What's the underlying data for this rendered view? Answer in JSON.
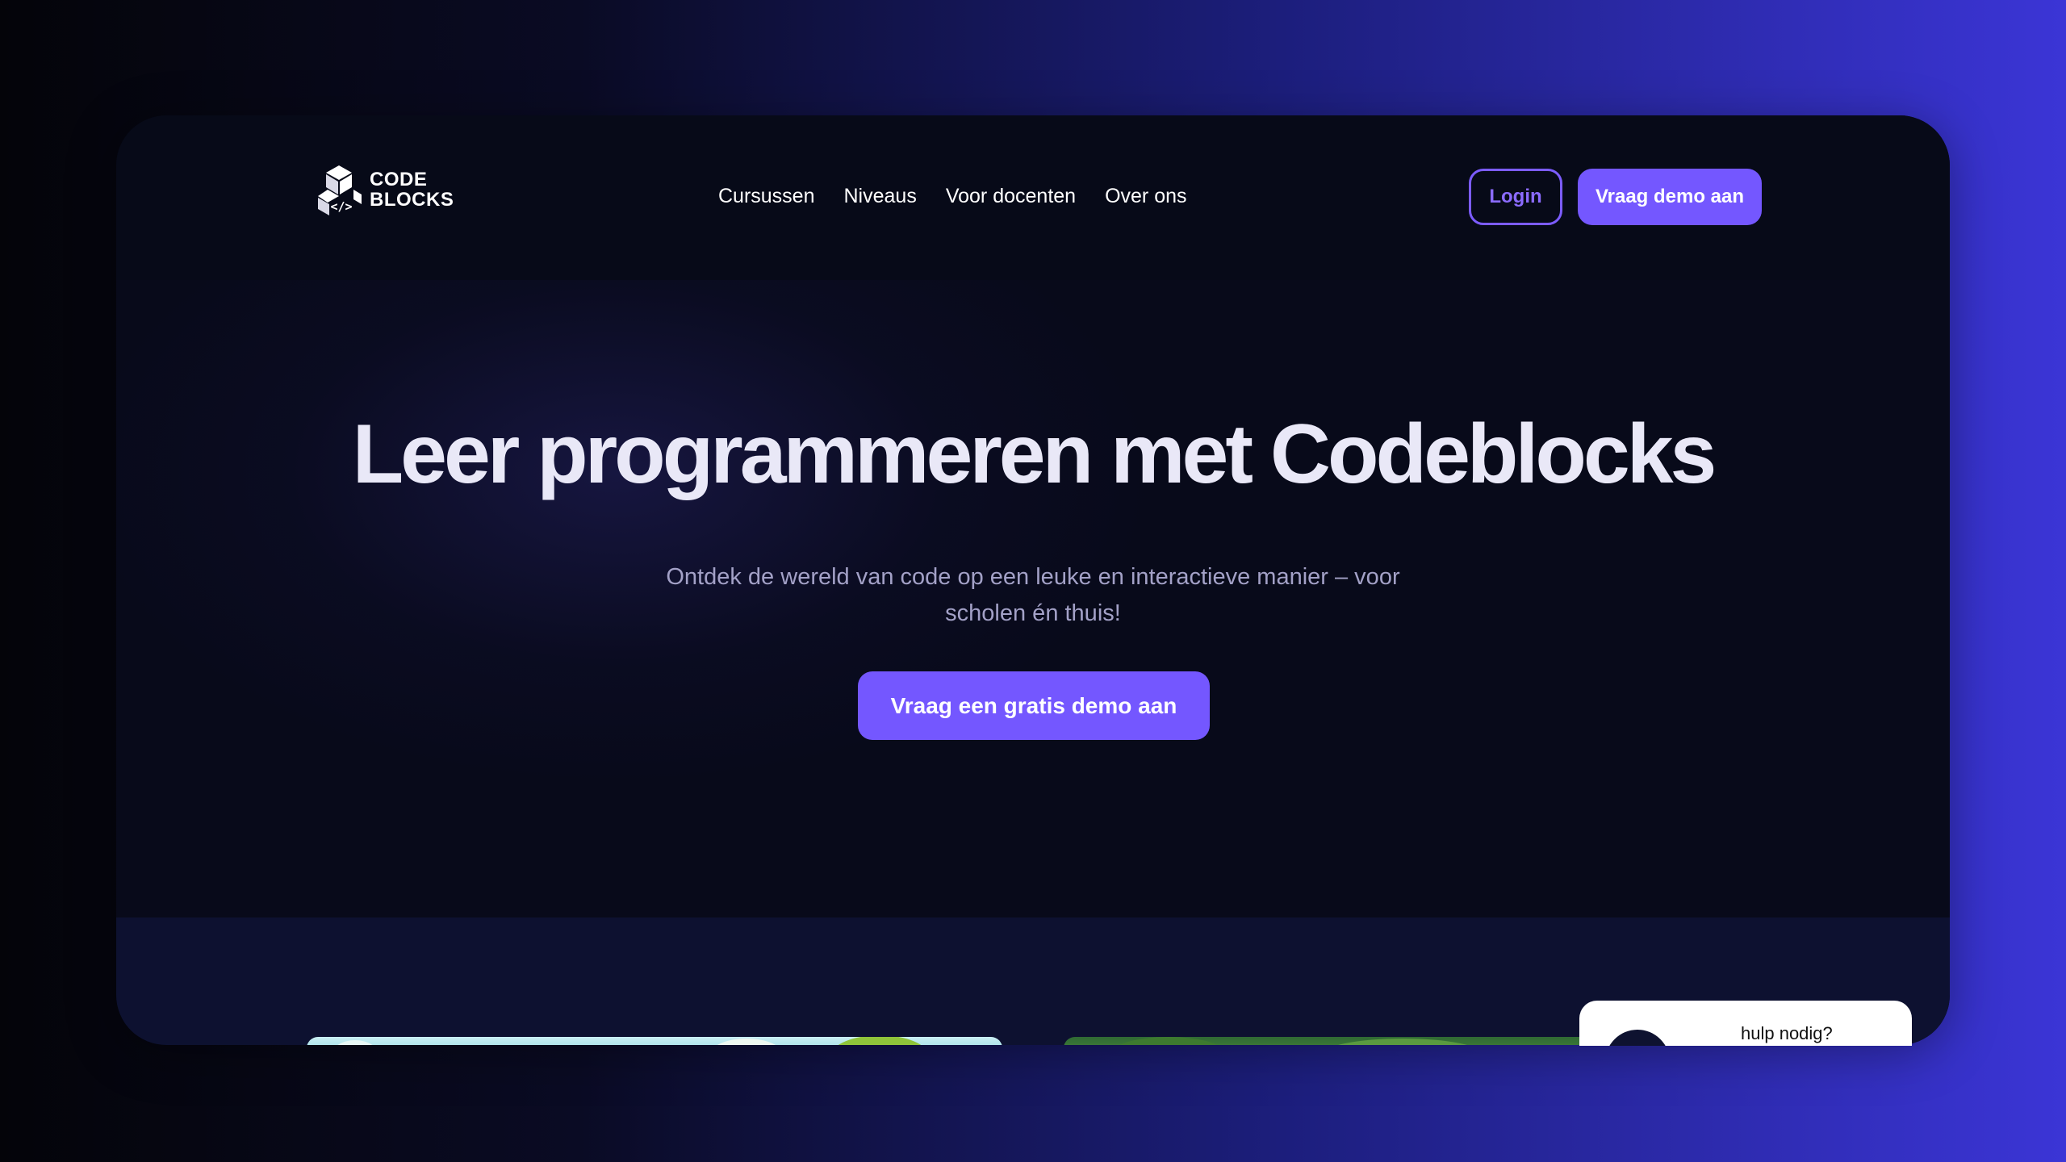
{
  "brand": {
    "logo_line1": "CODE",
    "logo_line2": "BLOCKS",
    "logo_icon": "cube-code-icon"
  },
  "nav": {
    "links": [
      "Cursussen",
      "Niveaus",
      "Voor docenten",
      "Over ons"
    ],
    "login_label": "Login",
    "demo_label": "Vraag demo aan"
  },
  "hero": {
    "title": "Leer programmeren met Codeblocks",
    "subtitle": "Ontdek de wereld van code op een leuke en interactieve manier – voor scholen én thuis!",
    "cta_label": "Vraag een gratis demo aan"
  },
  "help_widget": {
    "label": "hulp nodig?"
  },
  "colors": {
    "accent": "#7457ff",
    "page_bg": "#070a18",
    "title": "#e9e8f7",
    "subtitle": "#a3a1c7"
  }
}
